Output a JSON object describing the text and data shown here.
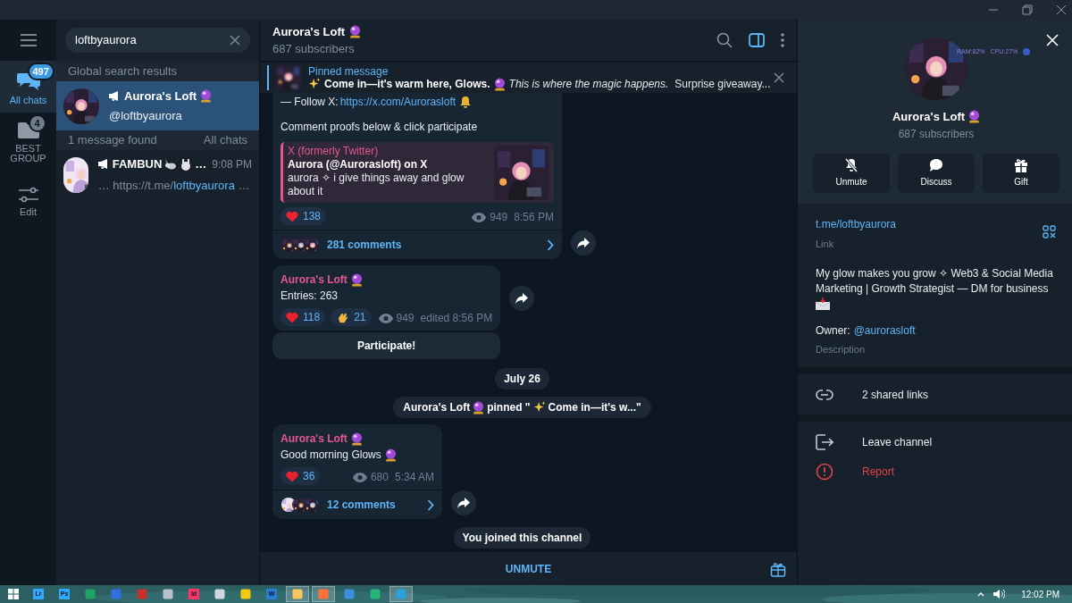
{
  "rail": {
    "items": [
      {
        "kind": "chats",
        "label": "All chats",
        "badge": "497",
        "selected": true
      },
      {
        "kind": "folder",
        "label": "BEST GROUP",
        "badge": "4",
        "selected": false
      },
      {
        "kind": "edit",
        "label": "Edit",
        "selected": false
      }
    ]
  },
  "search": {
    "value": "loftbyaurora"
  },
  "results": {
    "header": "Global search results",
    "items": [
      {
        "title": "Aurora's Loft",
        "subtitle": "@loftbyaurora",
        "selected": true
      }
    ],
    "messages_header": "1 message found",
    "messages_scope": "All chats",
    "messages": [
      {
        "title": "FAMBUN",
        "title_tail": "…",
        "time": "9:08 PM",
        "snippet_prefix": "… https://t.me/",
        "snippet_match": "loftbyaurora",
        "snippet_suffix": " …",
        "selected": false
      }
    ]
  },
  "chat": {
    "title": "Aurora's Loft",
    "subtitle": "687 subscribers",
    "pinned": {
      "label": "Pinned message",
      "bold": "Come in—it's warm here, Glows.",
      "italic": "This is where the magic happens.",
      "tail": "Surprise giveaway..."
    },
    "messages": [
      {
        "kind": "post",
        "follow_prefix": "— Follow X: ",
        "follow_link": "https://x.com/Aurorasloft",
        "text": "Comment proofs below & click participate",
        "preview": {
          "site": "X (formerly Twitter)",
          "title": "Aurora (@Aurorasloft) on X",
          "description": "aurora ✧ i give things away and glow about it"
        },
        "reactions": [
          {
            "kind": "heart",
            "count": "138"
          }
        ],
        "views": "949",
        "time": "8:56 PM",
        "comments": "281 comments"
      },
      {
        "kind": "post",
        "author": "Aurora's Loft",
        "text": "Entries: 263",
        "reactions": [
          {
            "kind": "heart",
            "count": "118"
          },
          {
            "kind": "clap",
            "count": "21"
          }
        ],
        "views": "949",
        "time": "edited 8:56 PM",
        "button": "Participate!"
      },
      {
        "kind": "date",
        "text": "July 26"
      },
      {
        "kind": "pin",
        "actor": "Aurora's Loft",
        "verb": "pinned \"",
        "quote": "Come in—it's w...\""
      },
      {
        "kind": "post",
        "author": "Aurora's Loft",
        "text": "Good morning Glows",
        "reactions": [
          {
            "kind": "heart",
            "count": "36"
          }
        ],
        "views": "680",
        "time": "5:34 AM",
        "comments": "12 comments"
      },
      {
        "kind": "service",
        "text": "You joined this channel"
      }
    ],
    "composer": {
      "button": "UNMUTE"
    }
  },
  "profile": {
    "overlay": [
      "RAM:82%",
      "CPU:27%"
    ],
    "title": "Aurora's Loft",
    "subtitle": "687 subscribers",
    "actions": [
      {
        "kind": "unmute",
        "label": "Unmute"
      },
      {
        "kind": "discuss",
        "label": "Discuss"
      },
      {
        "kind": "gift",
        "label": "Gift"
      }
    ],
    "link": "t.me/loftbyaurora",
    "link_caption": "Link",
    "bio": "My glow makes you grow ✧ Web3 & Social Media Marketing | Growth Strategist — DM for business",
    "owner_label": "Owner:",
    "owner_handle": "@aurorasloft",
    "bio_caption": "Description",
    "shared": "2 shared links",
    "leave": "Leave channel",
    "report": "Report"
  },
  "taskbar": {
    "apps": [
      {
        "kind": "start"
      },
      {
        "kind": "app",
        "label": "Lr",
        "color": "#31a8ff",
        "selected": false
      },
      {
        "kind": "app",
        "label": "Ps",
        "color": "#31a8ff",
        "selected": false
      },
      {
        "kind": "app",
        "color": "#21a366",
        "selected": false
      },
      {
        "kind": "app",
        "color": "#2f6fe0",
        "selected": false
      },
      {
        "kind": "app",
        "color": "#c8302c",
        "selected": false
      },
      {
        "kind": "app",
        "color": "#b9c2cc",
        "selected": false
      },
      {
        "kind": "app",
        "label": "Id",
        "color": "#ff3366",
        "selected": false
      },
      {
        "kind": "app",
        "color": "#cfd6dd",
        "selected": false
      },
      {
        "kind": "app",
        "color": "#f2c811",
        "selected": false
      },
      {
        "kind": "app",
        "label": "W",
        "color": "#2b7cd3",
        "selected": false
      },
      {
        "kind": "app",
        "color": "#f4c85a",
        "selected": true
      },
      {
        "kind": "app",
        "color": "#ff7139",
        "selected": true
      },
      {
        "kind": "app",
        "color": "#3c8fe0",
        "selected": false
      },
      {
        "kind": "app",
        "color": "#22b573",
        "selected": false
      },
      {
        "kind": "app",
        "color": "#2aa1da",
        "selected": true
      }
    ],
    "clock": "12:02 PM"
  }
}
